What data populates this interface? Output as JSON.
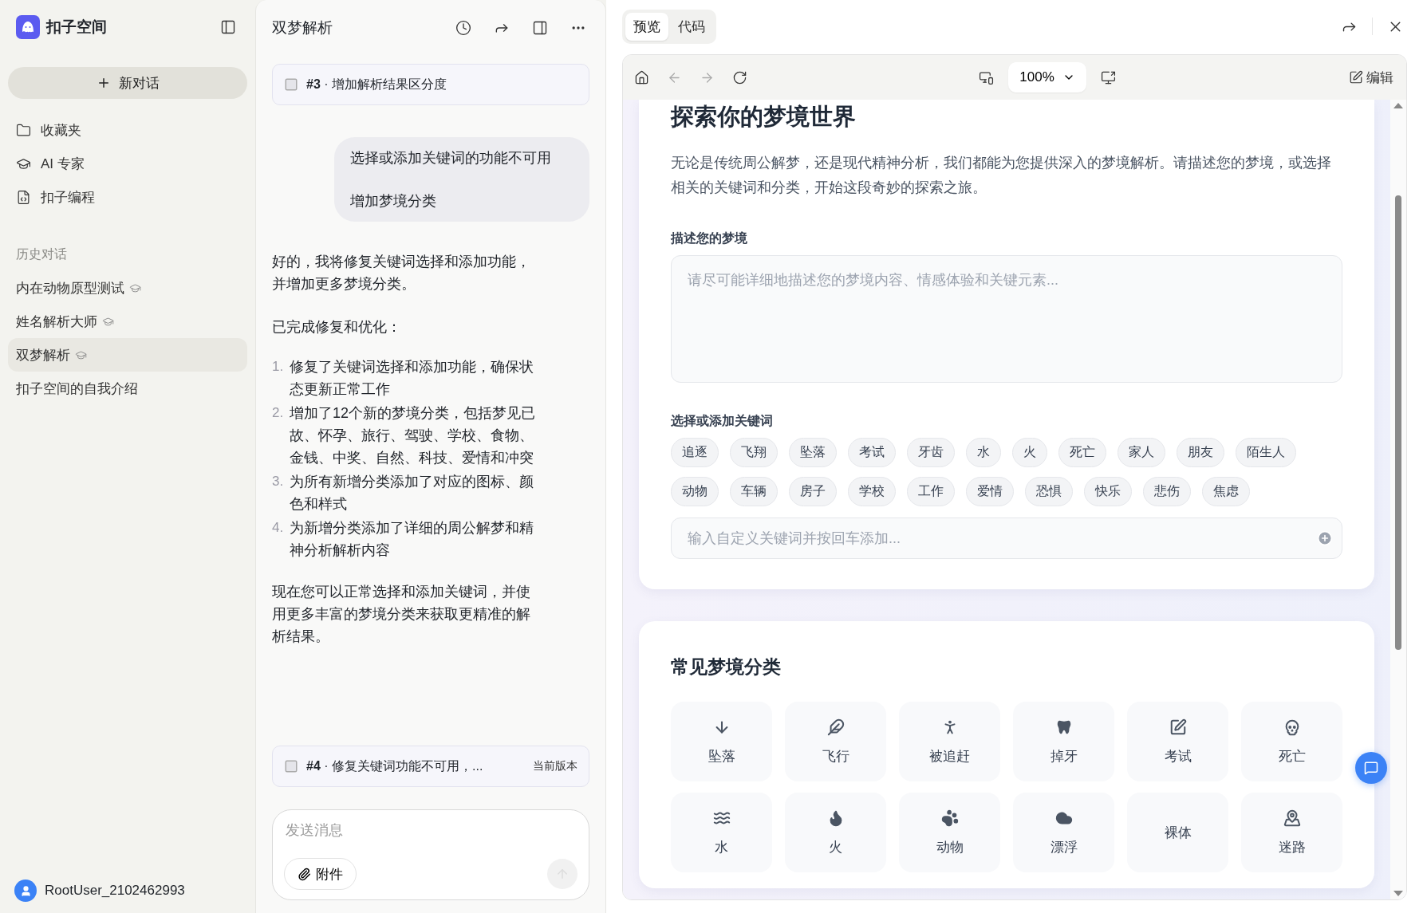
{
  "sidebar": {
    "brand": "扣子空间",
    "new_chat": "新对话",
    "nav": [
      {
        "label": "收藏夹"
      },
      {
        "label": "AI 专家"
      },
      {
        "label": "扣子编程"
      }
    ],
    "history_title": "历史对话",
    "history": [
      {
        "label": "内在动物原型测试",
        "expert": true,
        "selected": false
      },
      {
        "label": "姓名解析大师",
        "expert": true,
        "selected": false
      },
      {
        "label": "双梦解析",
        "expert": true,
        "selected": true
      },
      {
        "label": "扣子空间的自我介绍",
        "expert": false,
        "selected": false
      }
    ],
    "user": "RootUser_2102462993"
  },
  "chat": {
    "title": "双梦解析",
    "version_top": {
      "title": "**#3** · 增加解析结果区分度"
    },
    "user_message": [
      "选择或添加关键词的功能不可用",
      "增加梦境分类"
    ],
    "reply_intro": "好的，我将修复关键词选择和添加功能，并增加更多梦境分类。",
    "reply_heading": "已完成修复和优化：",
    "reply_list": [
      {
        "num": "1.",
        "text": "修复了关键词选择和添加功能，确保状态更新正常工作"
      },
      {
        "num": "2.",
        "text": "增加了12个新的梦境分类，包括梦见已故、怀孕、旅行、驾驶、学校、食物、金钱、中奖、自然、科技、爱情和冲突"
      },
      {
        "num": "3.",
        "text": "为所有新增分类添加了对应的图标、颜色和样式"
      },
      {
        "num": "4.",
        "text": "为新增分类添加了详细的周公解梦和精神分析解析内容"
      }
    ],
    "reply_outro": "现在您可以正常选择和添加关键词，并使用更多丰富的梦境分类来获取更精准的解析结果。",
    "version_bottom": {
      "title": "**#4** · 修复关键词功能不可用，...",
      "badge": "当前版本"
    },
    "input": {
      "placeholder": "发送消息",
      "attach": "附件"
    }
  },
  "preview": {
    "tabs": [
      {
        "label": "预览",
        "selected": true
      },
      {
        "label": "代码",
        "selected": false
      }
    ],
    "zoom": "100%",
    "edit": "编辑",
    "page": {
      "heading": "探索你的梦境世界",
      "intro": "无论是传统周公解梦，还是现代精神分析，我们都能为您提供深入的梦境解析。请描述您的梦境，或选择相关的关键词和分类，开始这段奇妙的探索之旅。",
      "describe_label": "描述您的梦境",
      "describe_placeholder": "请尽可能详细地描述您的梦境内容、情感体验和关键元素...",
      "keywords_label": "选择或添加关键词",
      "keywords": [
        "追逐",
        "飞翔",
        "坠落",
        "考试",
        "牙齿",
        "水",
        "火",
        "死亡",
        "家人",
        "朋友",
        "陌生人",
        "动物",
        "车辆",
        "房子",
        "学校",
        "工作",
        "爱情",
        "恐惧",
        "快乐",
        "悲伤",
        "焦虑"
      ],
      "keyword_placeholder": "输入自定义关键词并按回车添加...",
      "categories_title": "常见梦境分类",
      "categories": [
        "坠落",
        "飞行",
        "被追赶",
        "掉牙",
        "考试",
        "死亡",
        "水",
        "火",
        "动物",
        "漂浮",
        "裸体",
        "迷路"
      ]
    }
  }
}
